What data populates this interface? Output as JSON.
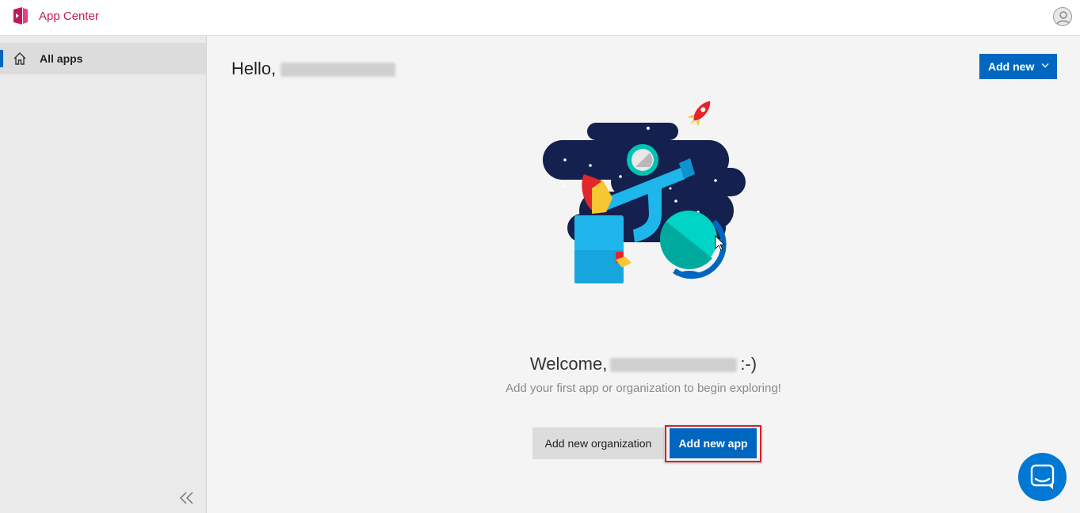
{
  "header": {
    "app_title": "App Center",
    "logo_icon": "app-center-logo-icon",
    "avatar_icon": "user-avatar-icon"
  },
  "sidebar": {
    "items": [
      {
        "label": "All apps",
        "icon": "home-icon",
        "active": true
      }
    ],
    "collapse_icon": "double-chevron-left-icon"
  },
  "main": {
    "greeting": "Hello,",
    "add_new_label": "Add new",
    "welcome_prefix": "Welcome,",
    "welcome_suffix": ":-)",
    "subtitle": "Add your first app or organization to begin exploring!",
    "add_org_label": "Add new organization",
    "add_app_label": "Add new app"
  },
  "chat": {
    "icon": "chat-icon"
  },
  "colors": {
    "accent": "#0067c0",
    "brand": "#c2185b",
    "highlight": "#d62024"
  }
}
